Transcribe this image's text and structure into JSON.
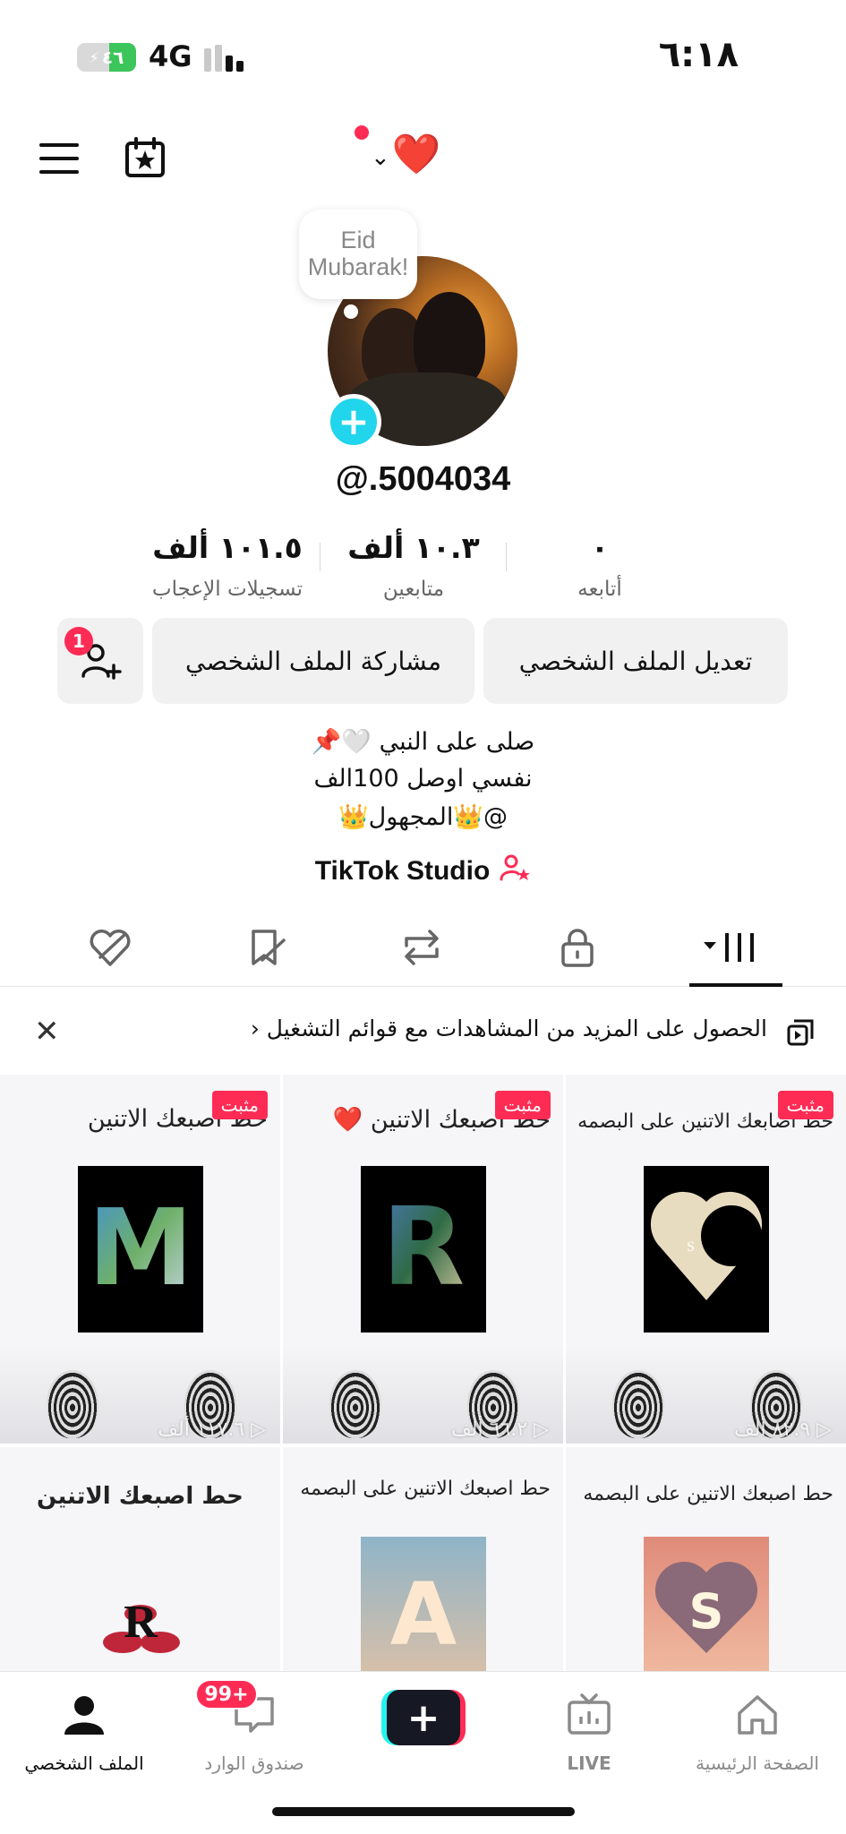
{
  "status_bar": {
    "battery": "٤٦",
    "battery_level": 0.46,
    "network": "4G",
    "time": "٦:١٨"
  },
  "header": {
    "account_emoji": "❤️"
  },
  "profile": {
    "bubble_text": "Eid Mubarak!",
    "username": "@.5004034",
    "stats": [
      {
        "value": "٠",
        "label": "أتابعه"
      },
      {
        "value": "١٠.٣ ألف",
        "label": "متابعين"
      },
      {
        "value": "١٠١.٥ ألف",
        "label": "تسجيلات الإعجاب"
      }
    ],
    "buttons": {
      "edit": "تعديل الملف الشخصي",
      "share": "مشاركة الملف الشخصي",
      "friend_badge": "1"
    },
    "bio": [
      "صلى على النبي 🤍📌",
      "نفسي اوصل 100الف",
      "@👑المجهول👑"
    ],
    "studio_link": "TikTok Studio"
  },
  "tabs": [
    "videos-grid",
    "private",
    "reposts",
    "favorites",
    "liked"
  ],
  "banner": {
    "text": "الحصول على المزيد من المشاهدات مع قوائم التشغيل"
  },
  "videos": [
    {
      "title": "حط اصابعك الاتنين على البصمه",
      "pinned": "مثبت",
      "views": "٨٢.٩ ألف",
      "thumb_letter": "S",
      "thumb_style": "moon"
    },
    {
      "title": "حط اصبعك الاتنين ❤️",
      "pinned": "مثبت",
      "views": "٦٦.٢ ألف",
      "thumb_letter": "R",
      "thumb_style": "earth"
    },
    {
      "title": "حط اصبعك الاتنين",
      "pinned": "مثبت",
      "views": "١١٧.٦ ألف",
      "thumb_letter": "M",
      "thumb_style": "earth-m"
    },
    {
      "title": "حط اصبعك الاتنين على البصمه",
      "thumb_letter": "S",
      "thumb_style": "heart-cloud"
    },
    {
      "title": "حط اصبعك الاتنين على البصمه",
      "thumb_letter": "A",
      "thumb_style": "sky"
    },
    {
      "title": "حط   اصبعك   الاتنين",
      "thumb_letter": "R",
      "thumb_style": "lips"
    }
  ],
  "bottom_nav": {
    "home": "الصفحة الرئيسية",
    "live": "LIVE",
    "inbox": "صندوق الوارد",
    "inbox_badge": "99+",
    "profile": "الملف الشخصي"
  },
  "colors": {
    "accent": "#fe2c55",
    "cyan": "#25f4ee",
    "avatar_add": "#20d5ec"
  }
}
